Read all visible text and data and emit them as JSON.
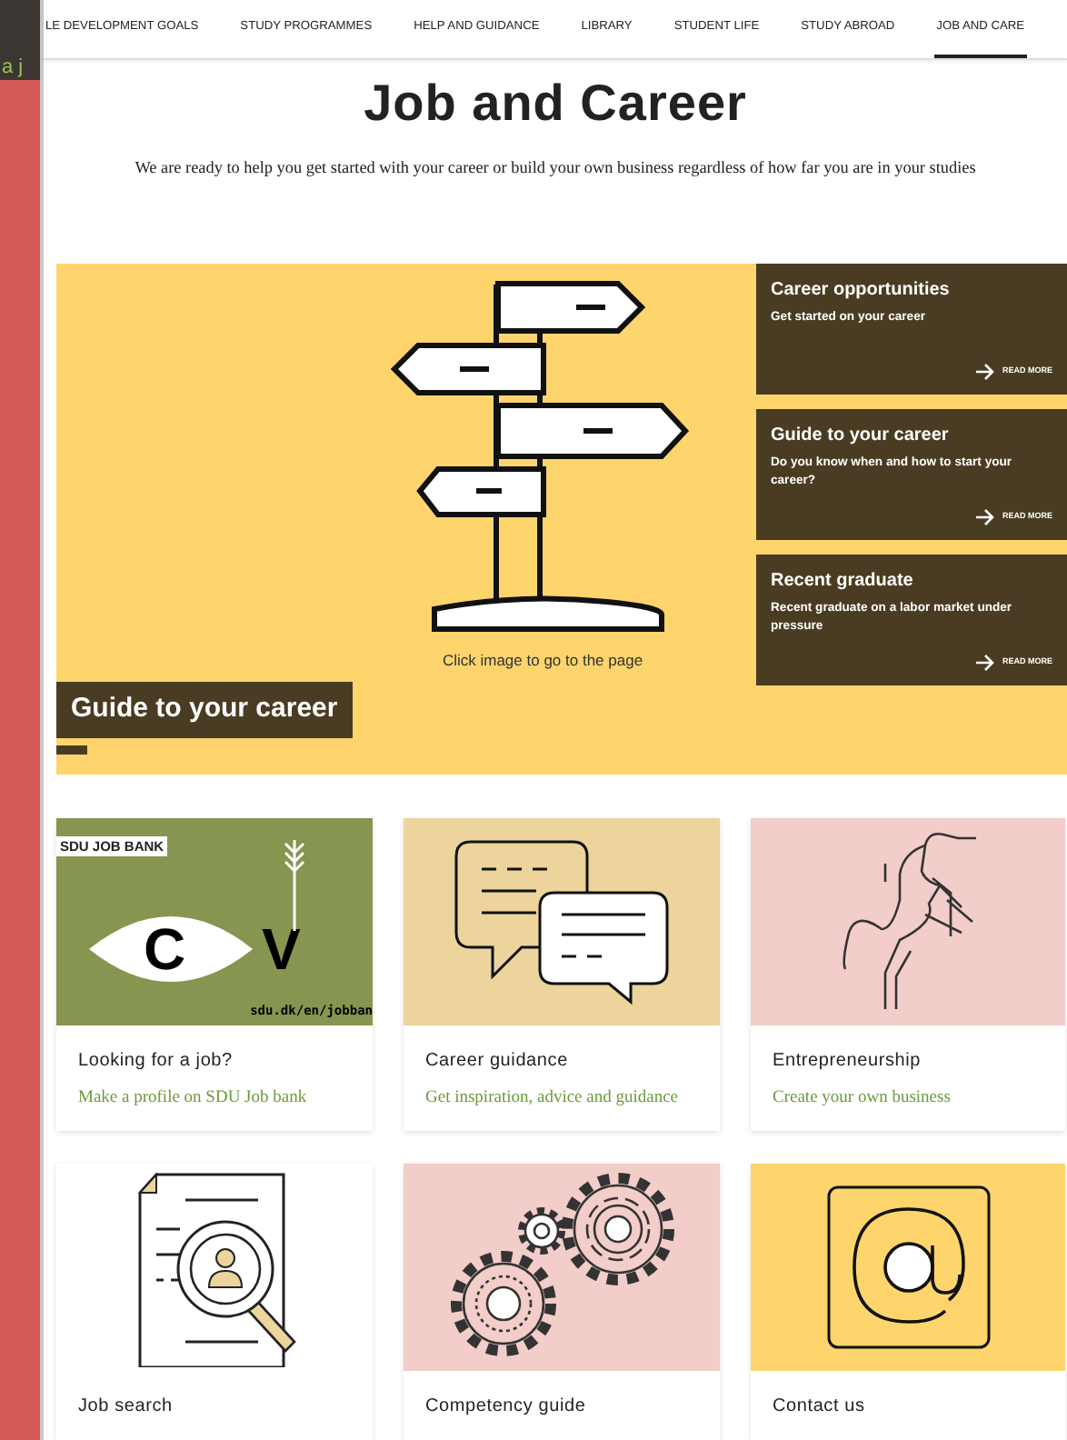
{
  "background_text": "a j",
  "nav": [
    {
      "label": "LE DEVELOPMENT GOALS",
      "selected": false
    },
    {
      "label": "STUDY PROGRAMMES",
      "selected": false
    },
    {
      "label": "HELP AND GUIDANCE",
      "selected": false
    },
    {
      "label": "LIBRARY",
      "selected": false
    },
    {
      "label": "STUDENT LIFE",
      "selected": false
    },
    {
      "label": "STUDY ABROAD",
      "selected": false
    },
    {
      "label": "JOB AND CARE",
      "selected": true
    }
  ],
  "title": "Job and Career",
  "intro": "We are ready to help you get started with your career or build your own business regardless of how far you are in your studies",
  "hero": {
    "label": "Guide to your career",
    "caption": "Click image to go to the page",
    "side_cards": [
      {
        "title": "Career opportunities",
        "text": "Get started on your career",
        "link": "READ MORE"
      },
      {
        "title": "Guide to your career",
        "text": "Do you know when and how to start your career?",
        "link": "READ MORE"
      },
      {
        "title": "Recent graduate",
        "text": "Recent graduate on a labor market under pressure",
        "link": "READ MORE"
      }
    ]
  },
  "cards": [
    {
      "kind": "cv",
      "title": "Looking for a job?",
      "subtitle": "Make a profile on SDU Job bank",
      "badge": "SDU JOB BANK",
      "letters": [
        "C",
        "V"
      ],
      "url": "sdu.dk/en/jobban"
    },
    {
      "kind": "chat",
      "title": "Career guidance",
      "subtitle": "Get inspiration, advice and guidance"
    },
    {
      "kind": "horse",
      "title": "Entrepreneurship",
      "subtitle": "Create your own business"
    },
    {
      "kind": "search",
      "title": "Job search"
    },
    {
      "kind": "gears",
      "title": "Competency guide"
    },
    {
      "kind": "at",
      "title": "Contact us"
    }
  ]
}
